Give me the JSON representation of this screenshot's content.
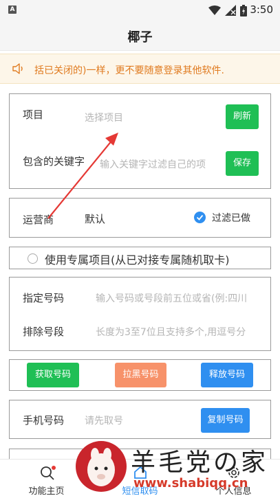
{
  "statusbar": {
    "time": "3:50",
    "notif_letter": "A"
  },
  "app": {
    "title": "椰子"
  },
  "notice": {
    "text": "括已关闭的)一样，更不要随意登录其他软件."
  },
  "project_card": {
    "project_label": "项目",
    "project_placeholder": "选择项目",
    "refresh_label": "刷新",
    "keyword_label": "包含的关键字",
    "keyword_placeholder": "输入关键字过滤自己的项",
    "save_label": "保存"
  },
  "operator_card": {
    "label": "运营商",
    "value": "默认",
    "filter_label": "过滤已做",
    "filter_checked": true
  },
  "exclusive": {
    "label": "使用专属项目(从已对接专属随机取卡)"
  },
  "number_card": {
    "specified_label": "指定号码",
    "specified_placeholder": "输入号码或号段前五位或省(例:四川",
    "exclude_label": "排除号段",
    "exclude_placeholder": "长度为3至7位且支持多个,用逗号分"
  },
  "actions": {
    "get_label": "获取号码",
    "block_label": "拉黑号码",
    "release_label": "释放号码"
  },
  "phone_card": {
    "label": "手机号码",
    "placeholder": "请先取号",
    "copy_label": "复制号码"
  },
  "nav": {
    "items": [
      {
        "label": "功能主页"
      },
      {
        "label": "短信取码"
      },
      {
        "label": "个人信息"
      }
    ]
  },
  "watermark": {
    "text": "羊毛党の家",
    "url": "www.shabiqq.cn"
  },
  "colors": {
    "accent": "#2f8ff0",
    "green": "#1fbf55",
    "salmon": "#f7926a",
    "warning": "#e07b20",
    "annotation": "#e53935"
  }
}
